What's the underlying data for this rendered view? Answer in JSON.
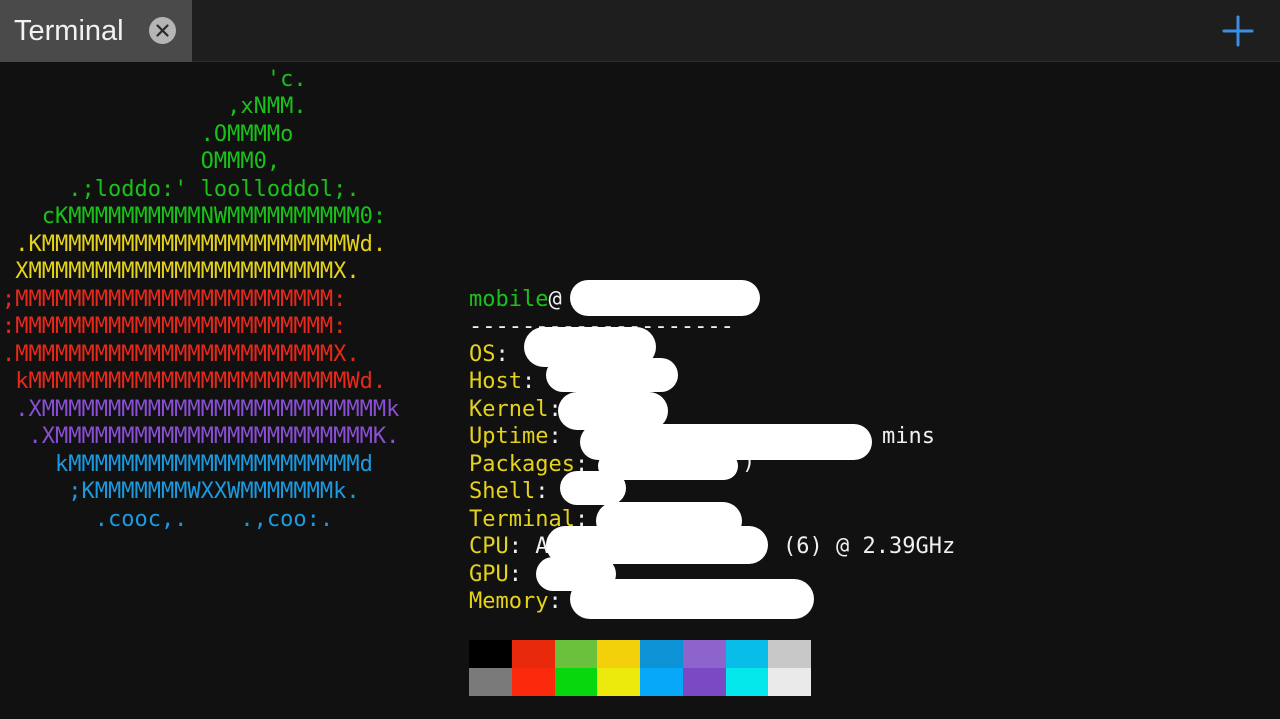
{
  "tab": {
    "title": "Terminal"
  },
  "icons": {
    "close": "close-icon",
    "new_tab": "plus-icon"
  },
  "logo_lines": [
    {
      "text": "                    'c.",
      "color": "green"
    },
    {
      "text": "                 ,xNMM.",
      "color": "green"
    },
    {
      "text": "               .OMMMMo",
      "color": "green"
    },
    {
      "text": "               OMMM0,",
      "color": "green"
    },
    {
      "text": "     .;loddo:' loolloddol;.",
      "color": "green"
    },
    {
      "text": "   cKMMMMMMMMMMNWMMMMMMMMMM0:",
      "color": "green"
    },
    {
      "text": " .KMMMMMMMMMMMMMMMMMMMMMMMWd.",
      "color": "yellow"
    },
    {
      "text": " XMMMMMMMMMMMMMMMMMMMMMMMX.",
      "color": "yellow"
    },
    {
      "text": ";MMMMMMMMMMMMMMMMMMMMMMMM:",
      "color": "red"
    },
    {
      "text": ":MMMMMMMMMMMMMMMMMMMMMMMM:",
      "color": "red"
    },
    {
      "text": ".MMMMMMMMMMMMMMMMMMMMMMMMX.",
      "color": "red"
    },
    {
      "text": " kMMMMMMMMMMMMMMMMMMMMMMMMWd.",
      "color": "red"
    },
    {
      "text": " .XMMMMMMMMMMMMMMMMMMMMMMMMMMk",
      "color": "purple"
    },
    {
      "text": "  .XMMMMMMMMMMMMMMMMMMMMMMMMK.",
      "color": "purple"
    },
    {
      "text": "    kMMMMMMMMMMMMMMMMMMMMMMd",
      "color": "blue"
    },
    {
      "text": "     ;KMMMMMMMWXXWMMMMMMMk.",
      "color": "blue"
    },
    {
      "text": "       .cooc,.    .,coo:.",
      "color": "blue"
    }
  ],
  "info": {
    "user": "mobile",
    "at": "@",
    "separator": "--------------------",
    "os_key": "OS",
    "host_key": "Host",
    "kernel_key": "Kernel",
    "uptime_key": "Uptime",
    "uptime_tail": "mins",
    "packages_key": "Packages",
    "packages_tail": ")",
    "shell_key": "Shell",
    "terminal_key": "Terminal",
    "cpu_key": "CPU",
    "cpu_head": "A",
    "cpu_tail": "(6) @ 2.39GHz",
    "gpu_key": "GPU",
    "memory_key": "Memory",
    "colon": ":"
  },
  "palette": {
    "top": [
      "#000000",
      "#e8290b",
      "#6ac23c",
      "#f3d10a",
      "#0c93d6",
      "#8d64cc",
      "#08bde8",
      "#c8c8c8"
    ],
    "bottom": [
      "#7a7a7a",
      "#fc2a0d",
      "#07d80d",
      "#ecea0c",
      "#08a8f9",
      "#7b49c3",
      "#04e8ec",
      "#eaeaea"
    ]
  },
  "colors": {
    "green": "#19c219",
    "yellow": "#e5d21a",
    "red": "#e8291a",
    "purple": "#8a4fd4",
    "blue": "#1a9ae0",
    "accent_plus": "#3a8ee6"
  }
}
